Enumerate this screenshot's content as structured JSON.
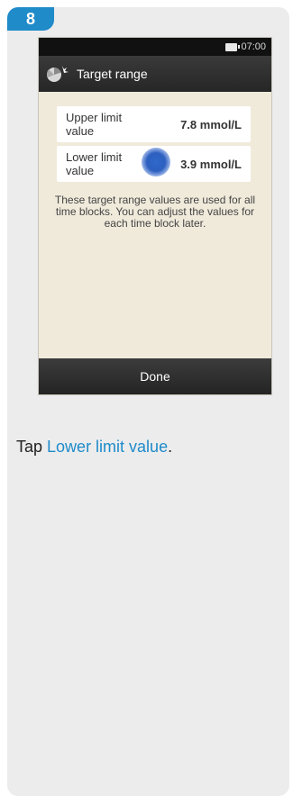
{
  "step": {
    "number": "8"
  },
  "status_bar": {
    "time": "07:00"
  },
  "screen": {
    "title": "Target range",
    "rows": [
      {
        "label": "Upper limit value",
        "value": "7.8 mmol/L"
      },
      {
        "label": "Lower limit value",
        "value": "3.9 mmol/L"
      }
    ],
    "info": "These target range values are used for all time blocks. You can adjust the values for each time block later.",
    "done_label": "Done"
  },
  "instruction": {
    "prefix": "Tap ",
    "link_text": "Lower limit value",
    "suffix": "."
  },
  "colors": {
    "accent": "#1f8bc9",
    "card_background": "#ececed",
    "screen_background": "#f0eadb"
  }
}
